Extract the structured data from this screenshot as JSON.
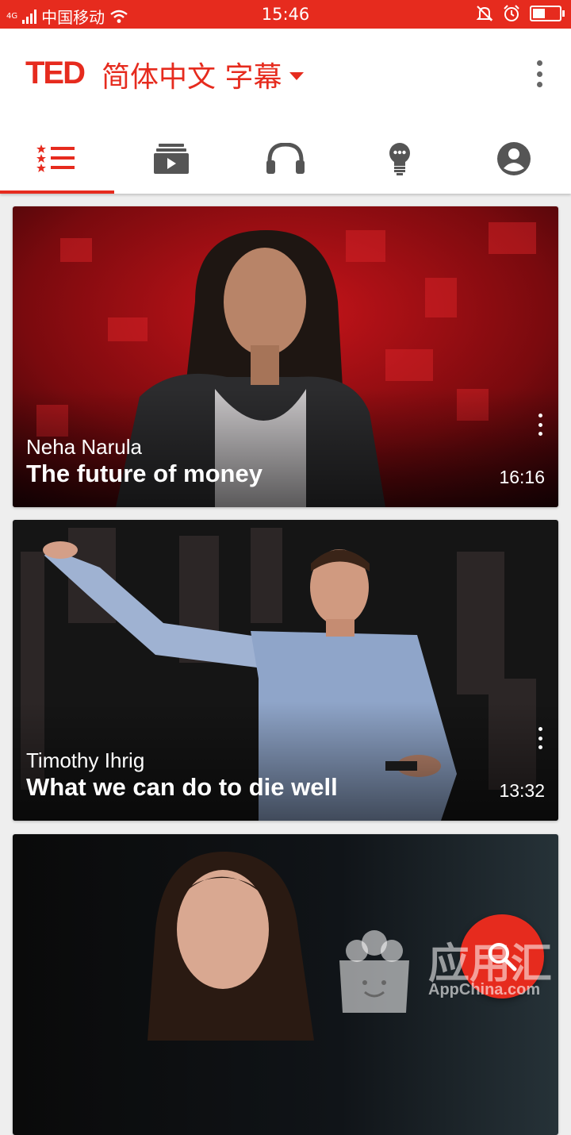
{
  "status_bar": {
    "network": "4G",
    "carrier": "中国移动",
    "time": "15:46",
    "battery_level": 0.55
  },
  "header": {
    "logo": "TED",
    "language": "简体中文 字幕",
    "accent_color": "#e62b1e"
  },
  "tabs": [
    {
      "name": "featured",
      "icon": "star-list-icon",
      "active": true
    },
    {
      "name": "playlists",
      "icon": "playlist-icon",
      "active": false
    },
    {
      "name": "podcasts",
      "icon": "headphones-icon",
      "active": false
    },
    {
      "name": "surprise-me",
      "icon": "lightbulb-icon",
      "active": false
    },
    {
      "name": "account",
      "icon": "account-icon",
      "active": false
    }
  ],
  "talks": [
    {
      "speaker": "Neha Narula",
      "title": "The future of money",
      "duration": "16:16"
    },
    {
      "speaker": "Timothy Ihrig",
      "title": "What we can do to die well",
      "duration": "13:32"
    },
    {
      "speaker": "",
      "title": "",
      "duration": ""
    }
  ],
  "fab": {
    "icon": "search-icon"
  },
  "watermark": {
    "text": "应用汇",
    "url": "AppChina.com"
  }
}
